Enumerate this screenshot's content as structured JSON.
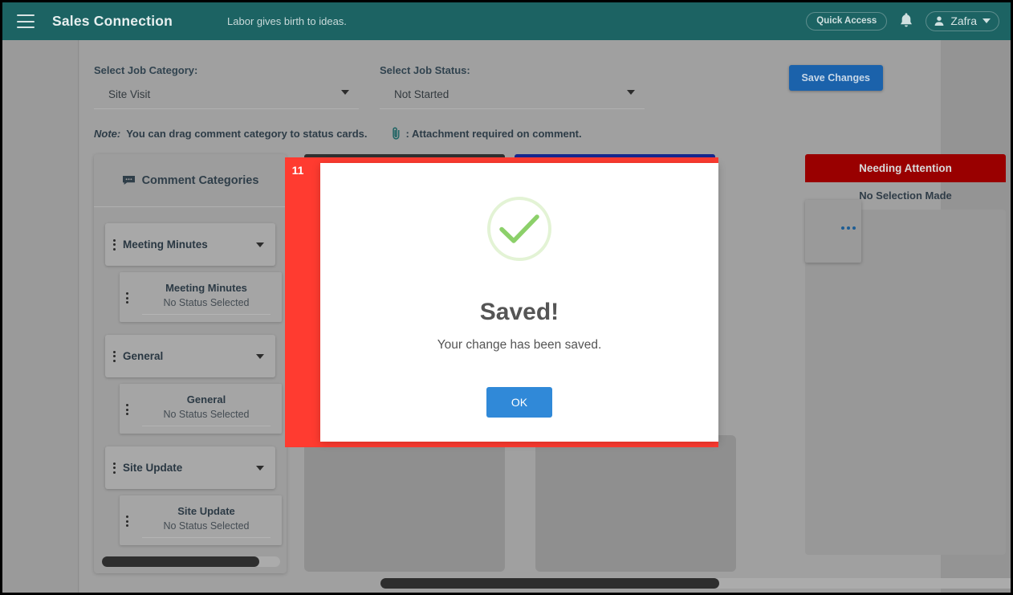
{
  "topbar": {
    "menu_icon": "hamburger-icon",
    "brand": "Sales Connection",
    "tagline": "Labor gives birth to ideas.",
    "quick_access": "Quick Access",
    "bell_icon": "bell-icon",
    "user_icon": "user-icon",
    "user_name": "Zafra",
    "caret_icon": "chevron-down-icon",
    "bg_color": "#1c6363"
  },
  "filters": {
    "job_category": {
      "label": "Select Job Category:",
      "value": "Site Visit",
      "caret_icon": "caret-down-icon"
    },
    "job_status": {
      "label": "Select Job Status:",
      "value": "Not Started",
      "caret_icon": "caret-down-icon"
    },
    "save_button": "Save Changes",
    "save_color": "#1b62ab"
  },
  "note": {
    "word": "Note:",
    "text": "You can drag comment category to status cards.",
    "clip_icon": "paperclip-icon",
    "clip_text": ": Attachment required on comment."
  },
  "categories_panel": {
    "header_icon": "comment-icon",
    "header": "Comment Categories",
    "items": [
      {
        "chip_label": "Meeting Minutes",
        "drag_icon": "drag-handle-icon",
        "caret_icon": "caret-down-icon",
        "card_title": "Meeting Minutes",
        "card_status": "No Status Selected"
      },
      {
        "chip_label": "General",
        "drag_icon": "drag-handle-icon",
        "caret_icon": "caret-down-icon",
        "card_title": "General",
        "card_status": "No Status Selected"
      },
      {
        "chip_label": "Site Update",
        "drag_icon": "drag-handle-icon",
        "caret_icon": "caret-down-icon",
        "card_title": "Site Update",
        "card_status": "No Status Selected"
      }
    ]
  },
  "status_columns": [
    {
      "title": "",
      "subtitle": "",
      "color": "#2f2f2f"
    },
    {
      "title": "",
      "subtitle": "",
      "color": "#16278c"
    },
    {
      "title": "Needing Attention",
      "subtitle": "No Selection Made",
      "color": "#990000"
    }
  ],
  "modal": {
    "badge": "11",
    "icon": "success-check-icon",
    "title": "Saved!",
    "message": "Your change has been saved.",
    "ok_label": "OK",
    "ok_color": "#3089d8",
    "highlight_color": "#ff3b30",
    "check_color": "#8cd06a"
  }
}
